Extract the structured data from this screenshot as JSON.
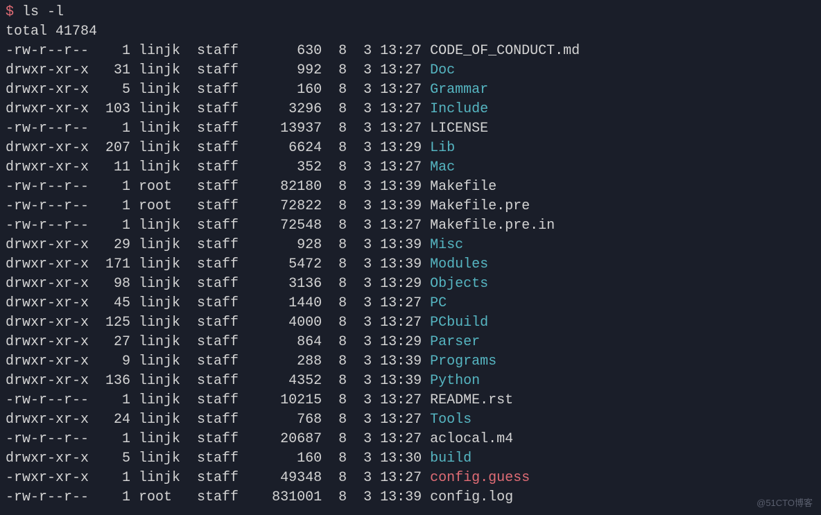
{
  "prompt": {
    "symbol": "$",
    "command": "ls -l"
  },
  "total_line": "total 41784",
  "rows": [
    {
      "perms": "-rw-r--r--",
      "links": "1",
      "owner": "linjk",
      "group": "staff",
      "size": "630",
      "month": "8",
      "day": "3",
      "time": "13:27",
      "name": "CODE_OF_CONDUCT.md",
      "kind": "file"
    },
    {
      "perms": "drwxr-xr-x",
      "links": "31",
      "owner": "linjk",
      "group": "staff",
      "size": "992",
      "month": "8",
      "day": "3",
      "time": "13:27",
      "name": "Doc",
      "kind": "dir"
    },
    {
      "perms": "drwxr-xr-x",
      "links": "5",
      "owner": "linjk",
      "group": "staff",
      "size": "160",
      "month": "8",
      "day": "3",
      "time": "13:27",
      "name": "Grammar",
      "kind": "dir"
    },
    {
      "perms": "drwxr-xr-x",
      "links": "103",
      "owner": "linjk",
      "group": "staff",
      "size": "3296",
      "month": "8",
      "day": "3",
      "time": "13:27",
      "name": "Include",
      "kind": "dir"
    },
    {
      "perms": "-rw-r--r--",
      "links": "1",
      "owner": "linjk",
      "group": "staff",
      "size": "13937",
      "month": "8",
      "day": "3",
      "time": "13:27",
      "name": "LICENSE",
      "kind": "file"
    },
    {
      "perms": "drwxr-xr-x",
      "links": "207",
      "owner": "linjk",
      "group": "staff",
      "size": "6624",
      "month": "8",
      "day": "3",
      "time": "13:29",
      "name": "Lib",
      "kind": "dir"
    },
    {
      "perms": "drwxr-xr-x",
      "links": "11",
      "owner": "linjk",
      "group": "staff",
      "size": "352",
      "month": "8",
      "day": "3",
      "time": "13:27",
      "name": "Mac",
      "kind": "dir"
    },
    {
      "perms": "-rw-r--r--",
      "links": "1",
      "owner": "root",
      "group": "staff",
      "size": "82180",
      "month": "8",
      "day": "3",
      "time": "13:39",
      "name": "Makefile",
      "kind": "file"
    },
    {
      "perms": "-rw-r--r--",
      "links": "1",
      "owner": "root",
      "group": "staff",
      "size": "72822",
      "month": "8",
      "day": "3",
      "time": "13:39",
      "name": "Makefile.pre",
      "kind": "file"
    },
    {
      "perms": "-rw-r--r--",
      "links": "1",
      "owner": "linjk",
      "group": "staff",
      "size": "72548",
      "month": "8",
      "day": "3",
      "time": "13:27",
      "name": "Makefile.pre.in",
      "kind": "file"
    },
    {
      "perms": "drwxr-xr-x",
      "links": "29",
      "owner": "linjk",
      "group": "staff",
      "size": "928",
      "month": "8",
      "day": "3",
      "time": "13:39",
      "name": "Misc",
      "kind": "dir"
    },
    {
      "perms": "drwxr-xr-x",
      "links": "171",
      "owner": "linjk",
      "group": "staff",
      "size": "5472",
      "month": "8",
      "day": "3",
      "time": "13:39",
      "name": "Modules",
      "kind": "dir"
    },
    {
      "perms": "drwxr-xr-x",
      "links": "98",
      "owner": "linjk",
      "group": "staff",
      "size": "3136",
      "month": "8",
      "day": "3",
      "time": "13:29",
      "name": "Objects",
      "kind": "dir"
    },
    {
      "perms": "drwxr-xr-x",
      "links": "45",
      "owner": "linjk",
      "group": "staff",
      "size": "1440",
      "month": "8",
      "day": "3",
      "time": "13:27",
      "name": "PC",
      "kind": "dir"
    },
    {
      "perms": "drwxr-xr-x",
      "links": "125",
      "owner": "linjk",
      "group": "staff",
      "size": "4000",
      "month": "8",
      "day": "3",
      "time": "13:27",
      "name": "PCbuild",
      "kind": "dir"
    },
    {
      "perms": "drwxr-xr-x",
      "links": "27",
      "owner": "linjk",
      "group": "staff",
      "size": "864",
      "month": "8",
      "day": "3",
      "time": "13:29",
      "name": "Parser",
      "kind": "dir"
    },
    {
      "perms": "drwxr-xr-x",
      "links": "9",
      "owner": "linjk",
      "group": "staff",
      "size": "288",
      "month": "8",
      "day": "3",
      "time": "13:39",
      "name": "Programs",
      "kind": "dir"
    },
    {
      "perms": "drwxr-xr-x",
      "links": "136",
      "owner": "linjk",
      "group": "staff",
      "size": "4352",
      "month": "8",
      "day": "3",
      "time": "13:39",
      "name": "Python",
      "kind": "dir"
    },
    {
      "perms": "-rw-r--r--",
      "links": "1",
      "owner": "linjk",
      "group": "staff",
      "size": "10215",
      "month": "8",
      "day": "3",
      "time": "13:27",
      "name": "README.rst",
      "kind": "file"
    },
    {
      "perms": "drwxr-xr-x",
      "links": "24",
      "owner": "linjk",
      "group": "staff",
      "size": "768",
      "month": "8",
      "day": "3",
      "time": "13:27",
      "name": "Tools",
      "kind": "dir"
    },
    {
      "perms": "-rw-r--r--",
      "links": "1",
      "owner": "linjk",
      "group": "staff",
      "size": "20687",
      "month": "8",
      "day": "3",
      "time": "13:27",
      "name": "aclocal.m4",
      "kind": "file"
    },
    {
      "perms": "drwxr-xr-x",
      "links": "5",
      "owner": "linjk",
      "group": "staff",
      "size": "160",
      "month": "8",
      "day": "3",
      "time": "13:30",
      "name": "build",
      "kind": "dir"
    },
    {
      "perms": "-rwxr-xr-x",
      "links": "1",
      "owner": "linjk",
      "group": "staff",
      "size": "49348",
      "month": "8",
      "day": "3",
      "time": "13:27",
      "name": "config.guess",
      "kind": "exec"
    },
    {
      "perms": "-rw-r--r--",
      "links": "1",
      "owner": "root",
      "group": "staff",
      "size": "831001",
      "month": "8",
      "day": "3",
      "time": "13:39",
      "name": "config.log",
      "kind": "file"
    }
  ],
  "watermark": "@51CTO博客"
}
